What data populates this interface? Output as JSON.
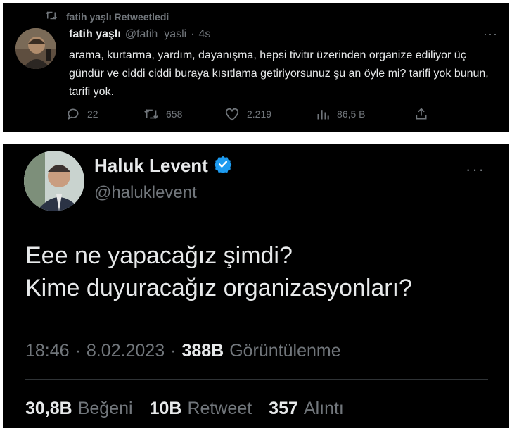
{
  "tweet1": {
    "retweet_label": "fatih yaşlı Retweetledi",
    "name": "fatih yaşlı",
    "handle": "@fatih_yasli",
    "separator": "·",
    "time": "4s",
    "text": "arama, kurtarma, yardım, dayanışma, hepsi tivitır üzerinden organize ediliyor üç gündür ve ciddi ciddi buraya kısıtlama getiriyorsunuz şu an öyle mi? tarifi yok bunun, tarifi yok.",
    "actions": {
      "replies": "22",
      "retweets": "658",
      "likes": "2.219",
      "views": "86,5 B"
    }
  },
  "tweet2": {
    "name": "Haluk Levent",
    "handle": "@haluklevent",
    "text_line1": "Eee ne yapacağız şimdi?",
    "text_line2": "Kime duyuracağız organizasyonları?",
    "time": "18:46",
    "separator": "·",
    "date": "8.02.2023",
    "views_count": "388B",
    "views_label": "Görüntülenme",
    "likes_count": "30,8B",
    "likes_label": "Beğeni",
    "retweets_count": "10B",
    "retweets_label": "Retweet",
    "quotes_count": "357",
    "quotes_label": "Alıntı"
  },
  "icons": {
    "retweet": "retweet-icon",
    "reply": "reply-icon",
    "like": "heart-icon",
    "views": "analytics-icon",
    "share": "share-icon",
    "more": "more-icon",
    "verified": "verified-badge-icon"
  },
  "colors": {
    "background": "#000000",
    "text": "#e7e9ea",
    "muted": "#71767b",
    "verified": "#1d9bf0"
  }
}
